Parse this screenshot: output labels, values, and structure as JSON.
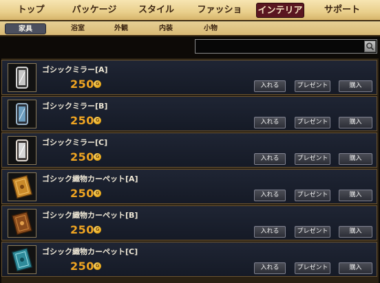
{
  "top_tabs": [
    {
      "label": "トップ",
      "active": false
    },
    {
      "label": "パッケージ",
      "active": false
    },
    {
      "label": "スタイル",
      "active": false
    },
    {
      "label": "ファッション",
      "active": false
    },
    {
      "label": "インテリア",
      "active": true
    },
    {
      "label": "サポート",
      "active": false
    }
  ],
  "sub_tabs": [
    {
      "label": "家具",
      "active": true
    },
    {
      "label": "浴室",
      "active": false
    },
    {
      "label": "外観",
      "active": false
    },
    {
      "label": "内装",
      "active": false
    },
    {
      "label": "小物",
      "active": false
    }
  ],
  "search": {
    "value": "",
    "placeholder": ""
  },
  "items": [
    {
      "name": "ゴシックミラー[A]",
      "price": "250",
      "coin": "G",
      "thumb": "mirror-icon",
      "tint": "#c8c8c8"
    },
    {
      "name": "ゴシックミラー[B]",
      "price": "250",
      "coin": "G",
      "thumb": "mirror-icon",
      "tint": "#6d9ec0"
    },
    {
      "name": "ゴシックミラー[C]",
      "price": "250",
      "coin": "G",
      "thumb": "mirror-icon",
      "tint": "#d8d8d8"
    },
    {
      "name": "ゴシック織物カーペット[A]",
      "price": "250",
      "coin": "G",
      "thumb": "carpet-icon",
      "tint": "#c98a2a"
    },
    {
      "name": "ゴシック織物カーペット[B]",
      "price": "250",
      "coin": "G",
      "thumb": "carpet-icon",
      "tint": "#8a4b1c"
    },
    {
      "name": "ゴシック織物カーペット[C]",
      "price": "250",
      "coin": "G",
      "thumb": "carpet-icon",
      "tint": "#2f8b9a"
    }
  ],
  "buttons": {
    "put_in": "入れる",
    "present": "プレゼント",
    "buy": "購入"
  }
}
